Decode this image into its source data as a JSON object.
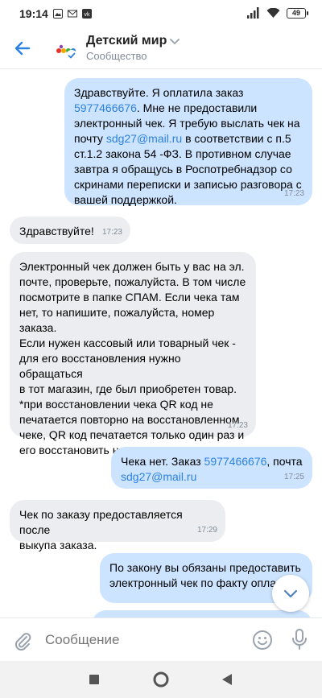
{
  "status_bar": {
    "time": "19:14",
    "battery": "49"
  },
  "header": {
    "title": "Детский мир",
    "subtitle": "Сообщество"
  },
  "messages": [
    {
      "direction": "out",
      "parts": [
        {
          "text": "Здравствуйте. Я оплатила заказ\n"
        },
        {
          "text": "5977466676",
          "link": true
        },
        {
          "text": ". Мне не предоставили\nэлектронный чек. Я требую выслать чек на\nпочту "
        },
        {
          "text": "sdg27@mail.ru",
          "link": true
        },
        {
          "text": " в соответствии с п.5\nст.1.2 закона 54 -ФЗ. В противном случае\nзавтра я обращусь в Роспотребнадзор со\nскринами переписки и записью разговора с\nвашей поддержкой."
        }
      ],
      "time": "17:23"
    },
    {
      "direction": "in",
      "parts": [
        {
          "text": "Здравствуйте!"
        }
      ],
      "time": "17:23"
    },
    {
      "direction": "in",
      "parts": [
        {
          "text": "Электронный чек должен быть у вас на эл.\nпочте, проверьте, пожалуйста. В том числе\nпосмотрите в папке СПАМ. Если чека там\nнет, то напишите, пожалуйста, номер\nзаказа.\nЕсли нужен кассовый или товарный чек -\nдля его восстановления нужно обращаться\nв тот магазин, где был приобретен товар.\n*при восстановлении чека QR код не\nпечатается повторно на восстановленном\nчеке, QR код печатается только один раз и\nего восстановить нельзя"
        }
      ],
      "time": "17:23"
    },
    {
      "direction": "out",
      "parts": [
        {
          "text": "Чека нет. Заказ "
        },
        {
          "text": "5977466676",
          "link": true
        },
        {
          "text": ", почта\n"
        },
        {
          "text": "sdg27@mail.ru",
          "link": true
        }
      ],
      "time": "17:25"
    },
    {
      "direction": "in",
      "parts": [
        {
          "text": "Чек по заказу предоставляется после\nвыкупа заказа."
        }
      ],
      "time": "17:29"
    },
    {
      "direction": "out",
      "parts": [
        {
          "text": "По закону вы обязаны предоставить\nэлектронный чек по факту опла"
        }
      ],
      "time": ""
    }
  ],
  "composer": {
    "placeholder": "Сообщение"
  },
  "colors": {
    "accent": "#2d81e0",
    "incoming_bubble": "#ebedf0",
    "outgoing_bubble": "#cce4ff",
    "secondary_text": "#818c99"
  }
}
